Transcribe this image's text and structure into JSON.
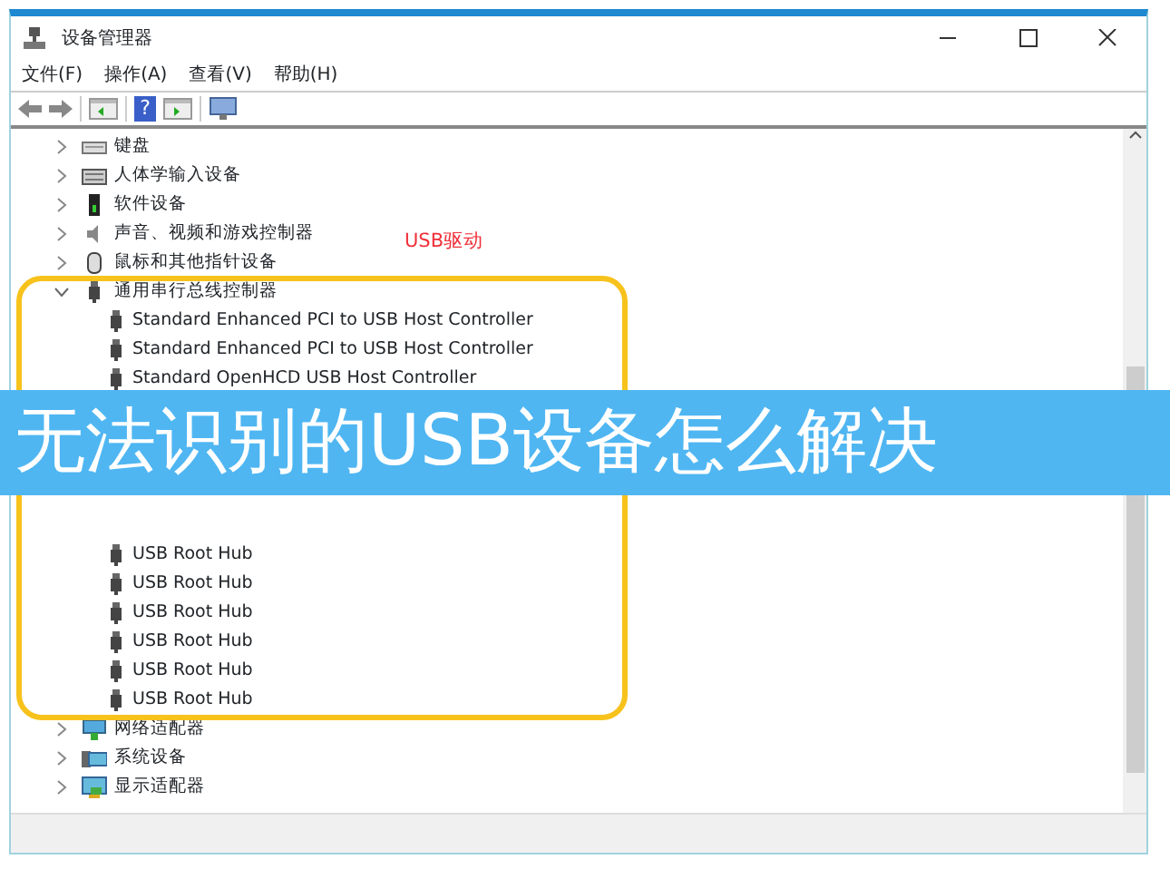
{
  "window": {
    "title": "设备管理器"
  },
  "menu": [
    "文件(F)",
    "操作(A)",
    "查看(V)",
    "帮助(H)"
  ],
  "toolbar": {
    "help_glyph": "?"
  },
  "tree": [
    {
      "label": "键盘",
      "kind": "keyboard",
      "expanded": false
    },
    {
      "label": "人体学输入设备",
      "kind": "hid",
      "expanded": false
    },
    {
      "label": "软件设备",
      "kind": "software",
      "expanded": false
    },
    {
      "label": "声音、视频和游戏控制器",
      "kind": "sound",
      "expanded": false
    },
    {
      "label": "鼠标和其他指针设备",
      "kind": "mouse",
      "expanded": false
    },
    {
      "label": "通用串行总线控制器",
      "kind": "usb",
      "expanded": true,
      "children": [
        {
          "label": "Standard Enhanced PCI to USB Host Controller"
        },
        {
          "label": "Standard Enhanced PCI to USB Host Controller"
        },
        {
          "label": "Standard OpenHCD USB Host Controller"
        },
        {
          "label": "USB Root Hub"
        },
        {
          "label": "USB Root Hub"
        },
        {
          "label": "USB Root Hub"
        },
        {
          "label": "USB Root Hub"
        },
        {
          "label": "USB Root Hub"
        },
        {
          "label": "USB Root Hub"
        }
      ]
    },
    {
      "label": "网络适配器",
      "kind": "network",
      "expanded": false
    },
    {
      "label": "系统设备",
      "kind": "system",
      "expanded": false
    },
    {
      "label": "显示适配器",
      "kind": "display",
      "expanded": false
    }
  ],
  "annotation": "USB驱动",
  "banner": "无法识别的USB设备怎么解决"
}
